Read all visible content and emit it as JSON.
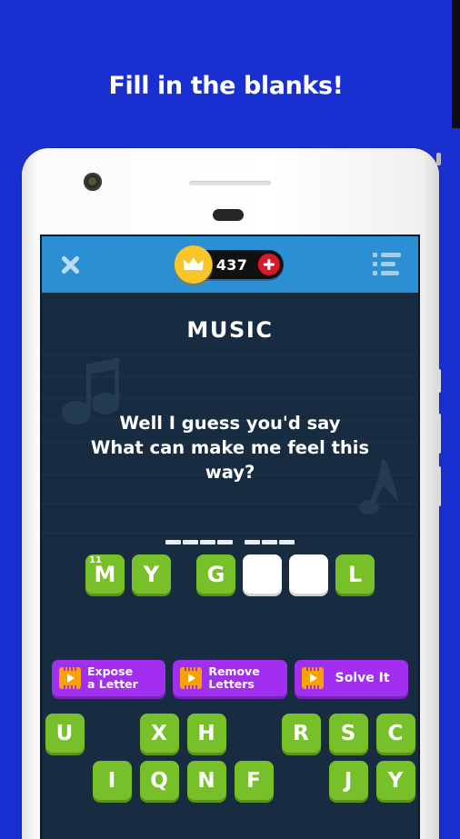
{
  "promo": {
    "headline": "Fill in the blanks!"
  },
  "topbar": {
    "close_icon": "close-icon",
    "menu_icon": "list-menu-icon",
    "crown_icon": "crown-icon",
    "coin_count": "437",
    "plus_label": "+"
  },
  "quiz": {
    "category": "MUSIC",
    "question_line1": "Well I guess you'd say",
    "question_line2": "What can make me feel this",
    "question_line3": "way?",
    "blank_groups": [
      4,
      3
    ],
    "slots": [
      {
        "letter": "M",
        "state": "filled",
        "index_badge": "11"
      },
      {
        "letter": "Y",
        "state": "filled",
        "index_badge": ""
      },
      {
        "letter": "",
        "state": "gap",
        "index_badge": ""
      },
      {
        "letter": "G",
        "state": "filled",
        "index_badge": ""
      },
      {
        "letter": "",
        "state": "empty",
        "index_badge": ""
      },
      {
        "letter": "",
        "state": "empty",
        "index_badge": ""
      },
      {
        "letter": "L",
        "state": "filled",
        "index_badge": ""
      }
    ]
  },
  "hints": [
    {
      "label": "Expose\na Letter",
      "icon": "video-ad-icon",
      "style": "two-line"
    },
    {
      "label": "Remove\nLetters",
      "icon": "video-ad-icon",
      "style": "two-line"
    },
    {
      "label": "Solve It",
      "icon": "video-ad-icon",
      "style": "one-line"
    }
  ],
  "keyboard": {
    "row1": [
      "U",
      "",
      "X",
      "H",
      "",
      "R",
      "S",
      "C"
    ],
    "row2": [
      "",
      "I",
      "Q",
      "N",
      "F",
      "",
      "J",
      "Y"
    ]
  },
  "colors": {
    "page_background": "#1a2fd0",
    "screen_background": "#172c41",
    "topbar_blue": "#2b8fd4",
    "tile_green": "#78c02a",
    "tile_green_shadow": "#5a9416",
    "hint_purple": "#a22ef0",
    "hint_purple_shadow": "#7b1ec0",
    "film_orange": "#f6a200",
    "crown_yellow": "#f8c62a",
    "plus_red": "#d9182c",
    "watermark_note": "#233b53"
  }
}
